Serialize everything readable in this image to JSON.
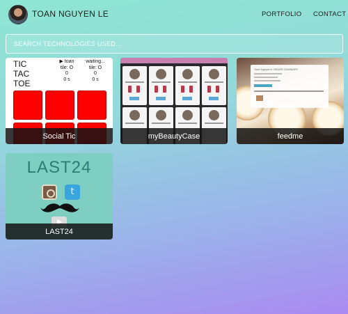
{
  "header": {
    "brand": "TOAN NGUYEN LE",
    "nav": {
      "portfolio": "PORTFOLIO",
      "contact": "CONTACT"
    }
  },
  "search": {
    "placeholder": "SEARCH TECHNOLOGIES USED..."
  },
  "projects": [
    {
      "label": "Social Tic",
      "preview": {
        "title": [
          "TIC",
          "TAC",
          "TOE"
        ],
        "player1": {
          "name": "▶ toan",
          "tile": "tile: O",
          "score": "0",
          "time": "0 s"
        },
        "player2": {
          "name": "waiting...",
          "tile": "tile: O",
          "score": "0",
          "time": "0 s"
        }
      }
    },
    {
      "label": "myBeautyCase"
    },
    {
      "label": "feedme",
      "preview": {
        "panel_title": "Toan Nguyen's ORDER SUMMARY"
      }
    },
    {
      "label": "LAST24",
      "preview": {
        "title": "LAST24"
      }
    }
  ],
  "colors": {
    "tic_cell": "#ff0000",
    "card_label_bg": "#141414",
    "last24_bg": "#7ecfc1",
    "beauty_topbar": "#c77fb0"
  }
}
